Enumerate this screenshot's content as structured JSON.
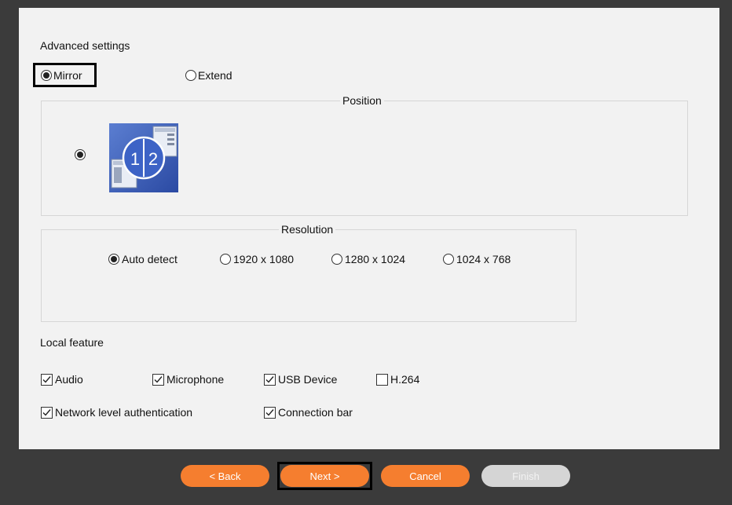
{
  "advanced": {
    "title": "Advanced settings",
    "mode_options": [
      {
        "label": "Mirror",
        "selected": true
      },
      {
        "label": "Extend",
        "selected": false
      }
    ]
  },
  "position": {
    "title": "Position",
    "icon_numbers": [
      "1",
      "2"
    ]
  },
  "resolution": {
    "title": "Resolution",
    "options": [
      {
        "label": "Auto detect",
        "selected": true
      },
      {
        "label": "1920 x 1080",
        "selected": false
      },
      {
        "label": "1280 x 1024",
        "selected": false
      },
      {
        "label": "1024 x 768",
        "selected": false
      }
    ]
  },
  "local_feature": {
    "title": "Local feature",
    "options": [
      {
        "label": "Audio",
        "checked": true
      },
      {
        "label": "Microphone",
        "checked": true
      },
      {
        "label": "USB Device",
        "checked": true
      },
      {
        "label": "H.264",
        "checked": false
      },
      {
        "label": "Network level authentication",
        "checked": true
      },
      {
        "label": "Connection bar",
        "checked": true
      }
    ]
  },
  "buttons": {
    "back": "< Back",
    "next": "Next >",
    "cancel": "Cancel",
    "finish": "Finish"
  },
  "colors": {
    "button_orange": "#f57e2f",
    "button_disabled": "#d5d5d5",
    "frame_dark": "#3b3b3b",
    "panel_bg": "#f2f2f2"
  }
}
